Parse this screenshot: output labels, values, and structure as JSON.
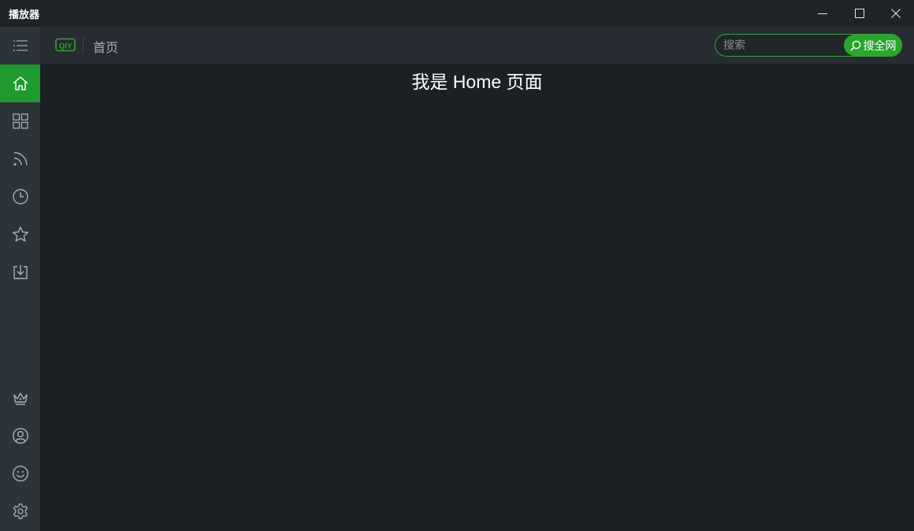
{
  "window": {
    "title": "播放器",
    "controls": [
      "minimize-icon",
      "maximize-icon",
      "close-icon"
    ]
  },
  "sidebar": {
    "menu_icon": "list-menu-icon",
    "items": [
      {
        "id": "home",
        "icon": "home-icon",
        "active": true
      },
      {
        "id": "categories",
        "icon": "grid-icon",
        "active": false
      },
      {
        "id": "subscriptions",
        "icon": "rss-icon",
        "active": false
      },
      {
        "id": "history",
        "icon": "clock-icon",
        "active": false
      },
      {
        "id": "favorites",
        "icon": "star-icon",
        "active": false
      },
      {
        "id": "downloads",
        "icon": "download-icon",
        "active": false
      }
    ],
    "bottom_items": [
      {
        "id": "vip",
        "icon": "crown-icon"
      },
      {
        "id": "account",
        "icon": "user-icon"
      },
      {
        "id": "feedback",
        "icon": "smile-icon"
      },
      {
        "id": "settings",
        "icon": "gear-icon"
      }
    ]
  },
  "header": {
    "logo": "iqiyi-logo-icon",
    "breadcrumb": "首页"
  },
  "search": {
    "placeholder": "搜索",
    "value": "",
    "button_label": "搜全网"
  },
  "main": {
    "heading": "我是 Home 页面"
  },
  "colors": {
    "accent": "#2aa52e",
    "sidebar_bg": "#2c3339",
    "topbar_bg": "#262c31",
    "content_bg": "#1b2024",
    "titlebar_bg": "#1f2226"
  }
}
